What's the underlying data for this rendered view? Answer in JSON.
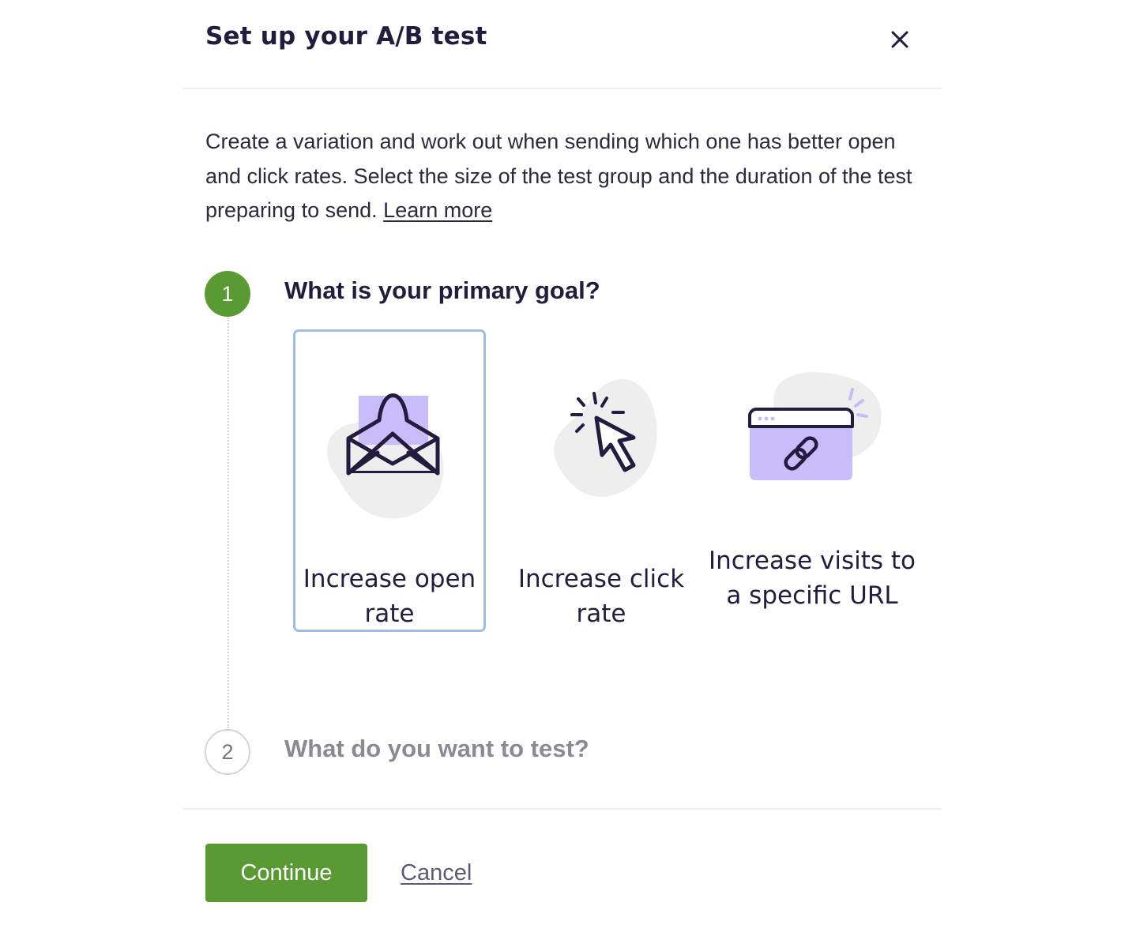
{
  "dialog": {
    "title": "Set up your A/B test",
    "close_icon": "close-icon"
  },
  "intro": {
    "text": "Create a variation and work out when sending which one has better open and click rates. Select the size of the test group and the duration of the test preparing to send.",
    "learn_more": "Learn more"
  },
  "steps": [
    {
      "number": "1",
      "title": "What is your primary goal?",
      "active": true
    },
    {
      "number": "2",
      "title": "What do you want to test?",
      "active": false
    }
  ],
  "goals": [
    {
      "label": "Increase open rate",
      "icon": "open-envelope-icon",
      "selected": true
    },
    {
      "label": "Increase click rate",
      "icon": "cursor-click-icon",
      "selected": false
    },
    {
      "label": "Increase visits to a specific URL",
      "icon": "browser-link-icon",
      "selected": false
    }
  ],
  "footer": {
    "continue_label": "Continue",
    "cancel_label": "Cancel"
  },
  "colors": {
    "accent_green": "#5a9a33",
    "selection_border": "#9dbde8",
    "illustration_purple": "#c9bcfb",
    "text_dark": "#241c3e"
  }
}
